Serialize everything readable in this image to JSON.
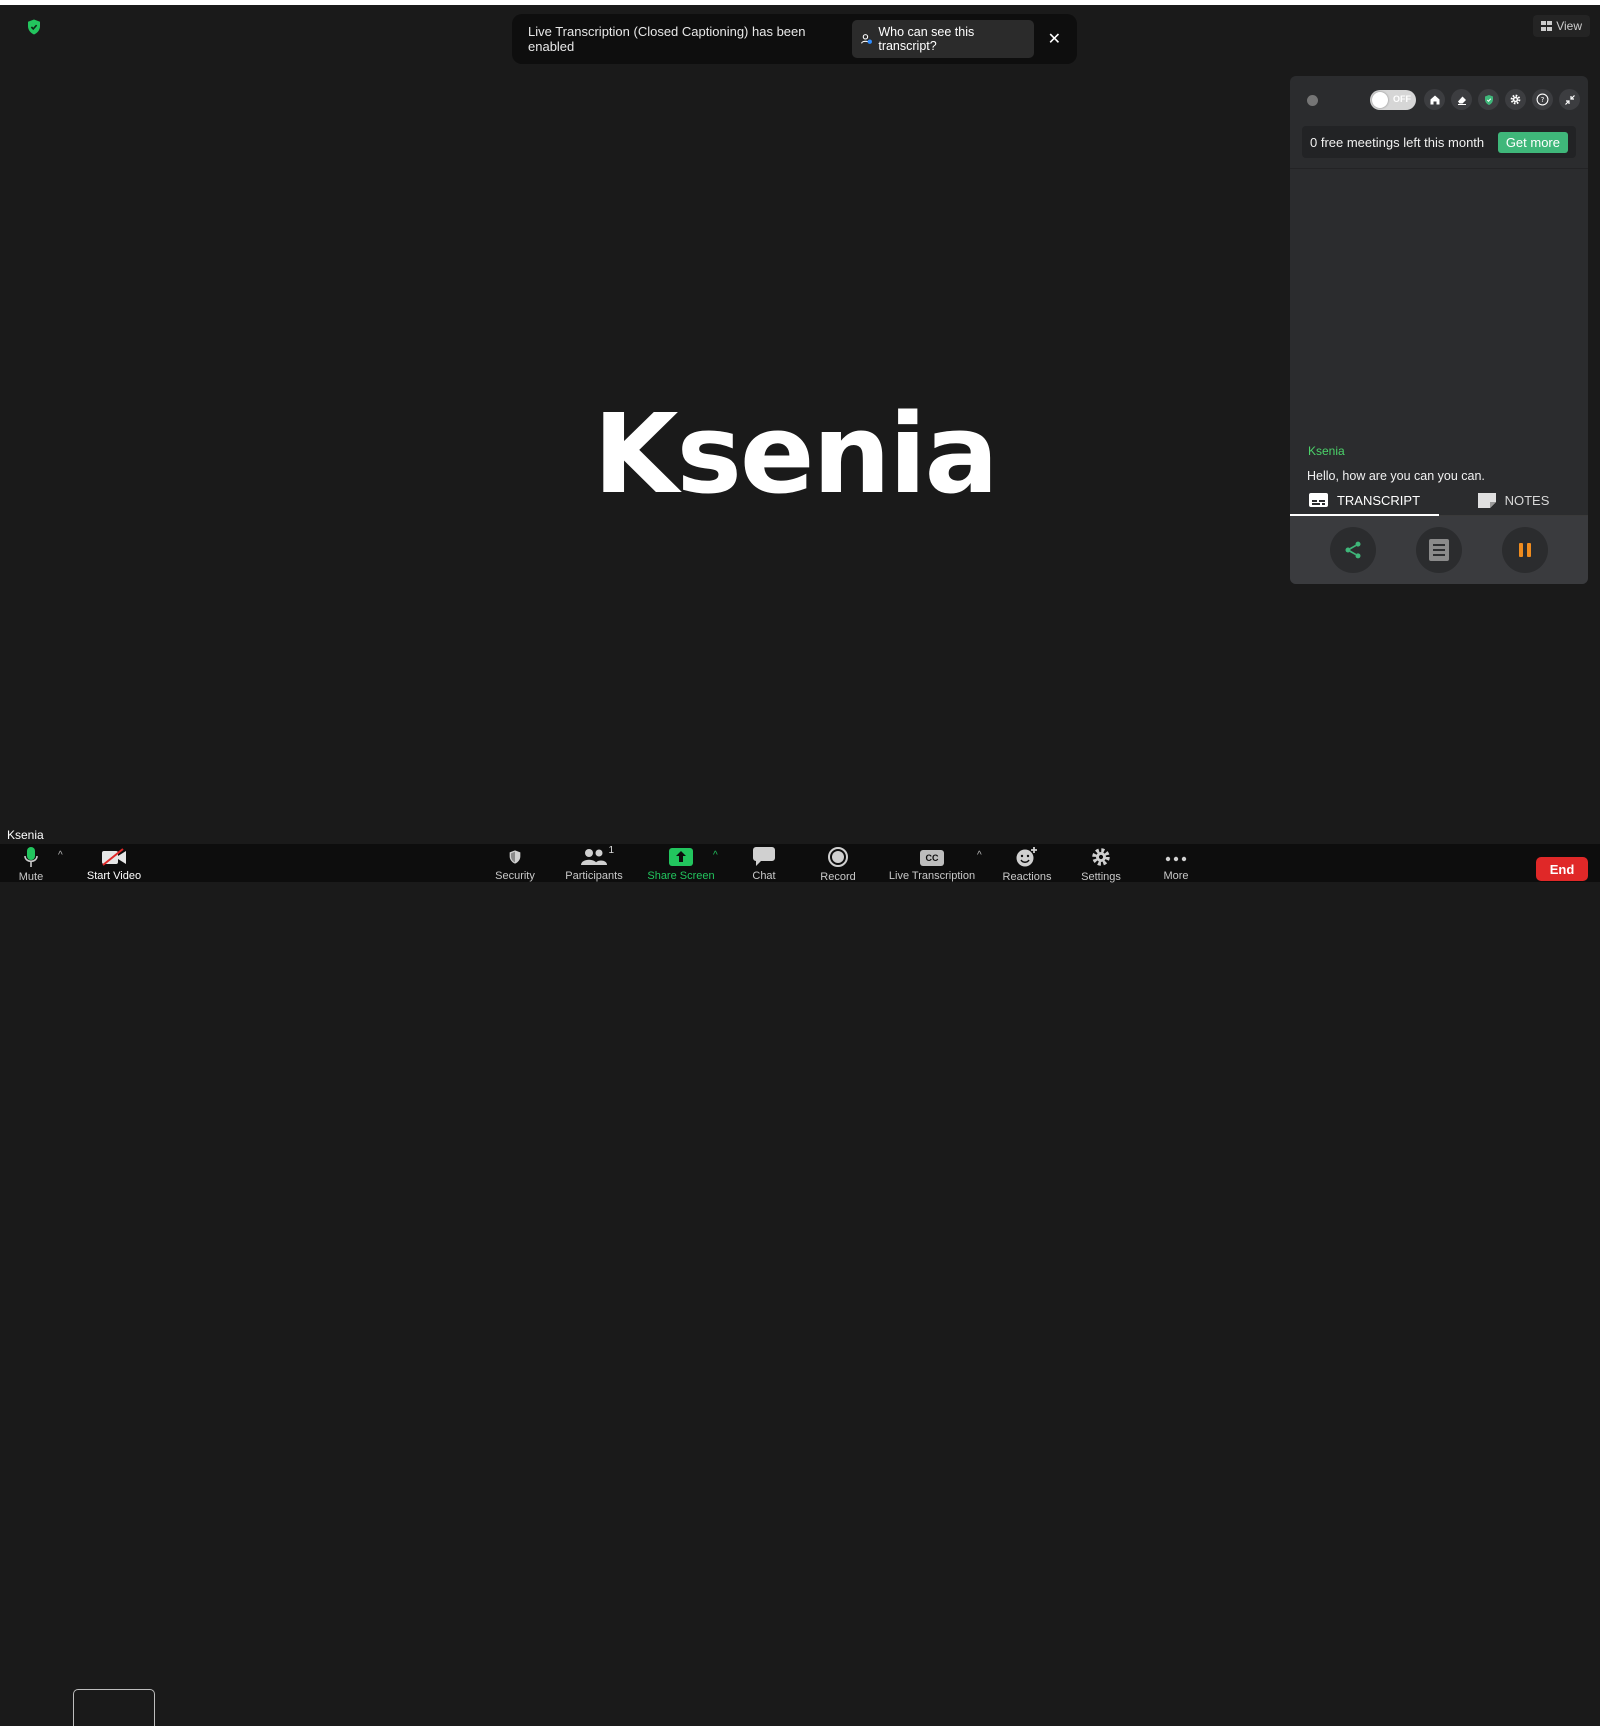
{
  "banner": {
    "message": "Live Transcription (Closed Captioning) has been enabled",
    "who_label": "Who can see this transcript?",
    "close_glyph": "✕"
  },
  "view_button": "View",
  "speaker_name_big": "Ksenia",
  "panel": {
    "toggle_text": "OFF",
    "free_meetings_text": "0 free meetings left this month",
    "get_more_label": "Get more",
    "transcript_speaker": "Ksenia",
    "transcript_text": "Hello, how are you can you can.",
    "tabs": [
      {
        "label": "TRANSCRIPT",
        "icon": "captions-icon",
        "active": true
      },
      {
        "label": "NOTES",
        "icon": "note-icon",
        "active": false
      }
    ]
  },
  "name_tag": "Ksenia",
  "toolbar": {
    "mute": "Mute",
    "start_video": "Start Video",
    "security": "Security",
    "participants": "Participants",
    "participants_count": "1",
    "share_screen": "Share Screen",
    "chat": "Chat",
    "record": "Record",
    "live_transcription": "Live Transcription",
    "cc_glyph": "CC",
    "reactions": "Reactions",
    "settings": "Settings",
    "more": "More",
    "end": "End",
    "caret_glyph": "^"
  },
  "colors": {
    "accent_green": "#3fb77a",
    "speaker_green": "#4bd36a",
    "end_red": "#e02828",
    "pause_orange": "#f08c1e"
  }
}
